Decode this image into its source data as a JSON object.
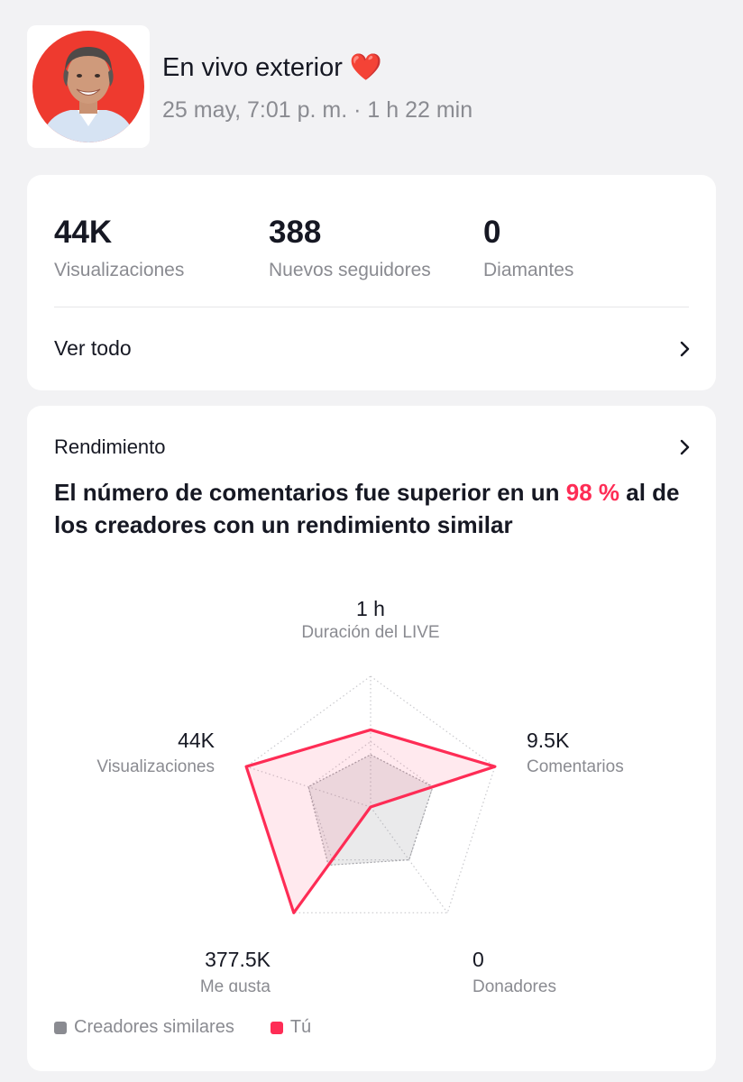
{
  "header": {
    "title": "En vivo exterior ❤️",
    "subtitle": "25 may, 7:01 p. m. · 1 h 22 min"
  },
  "summary": {
    "stats": [
      {
        "value": "44K",
        "label": "Visualizaciones"
      },
      {
        "value": "388",
        "label": "Nuevos seguidores"
      },
      {
        "value": "0",
        "label": "Diamantes"
      }
    ],
    "see_all_label": "Ver todo"
  },
  "performance": {
    "section_title": "Rendimiento",
    "headline_before": "El número de comentarios fue superior en un ",
    "headline_highlight": "98 %",
    "headline_after": " al de los creadores con un rendimiento similar"
  },
  "colors": {
    "accent": "#fe2c55",
    "similar_creators": "#8a8b91"
  },
  "chart_data": {
    "type": "radar",
    "axes": [
      {
        "name": "Duración del LIVE",
        "value": "1 h"
      },
      {
        "name": "Comentarios",
        "value": "9.5K"
      },
      {
        "name": "Donadores",
        "value": "0"
      },
      {
        "name": "Me gusta",
        "value": "377.5K"
      },
      {
        "name": "Visualizaciones",
        "value": "44K"
      }
    ],
    "rmax": 1,
    "series": [
      {
        "name": "Creadores similares",
        "values": [
          0.4,
          0.5,
          0.5,
          0.55,
          0.5
        ]
      },
      {
        "name": "Tú",
        "values": [
          0.59,
          1.0,
          0.0,
          1.0,
          1.0
        ]
      }
    ],
    "legend": [
      {
        "label": "Creadores similares",
        "color": "#8a8b91"
      },
      {
        "label": "Tú",
        "color": "#fe2c55"
      }
    ]
  }
}
